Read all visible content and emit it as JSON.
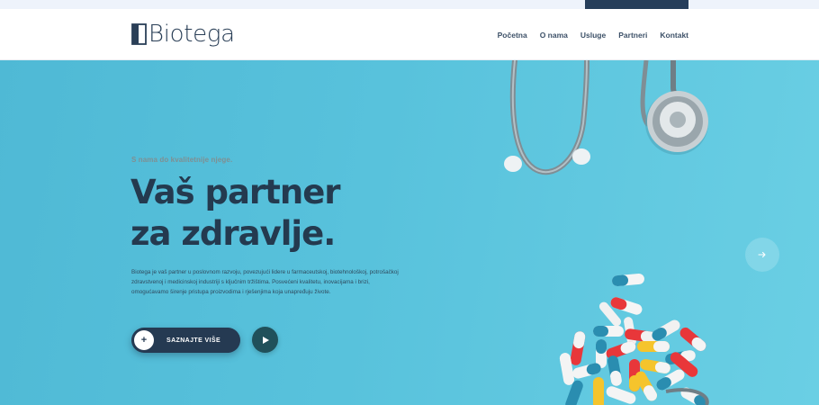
{
  "brand": {
    "name": "Biotega"
  },
  "nav": {
    "items": [
      "Početna",
      "O nama",
      "Usluge",
      "Partneri",
      "Kontakt"
    ]
  },
  "hero": {
    "tagline": "S nama do kvalitetnije njege.",
    "headline_line1": "Vaš partner",
    "headline_line2": "za zdravlje.",
    "description": "Biotega je vaš partner u poslovnom razvoju, povezujući lidere u farmaceutskoj, biotehnološkoj, potrošačkoj zdravstvenoj i medicinskoj industriji s ključnim tržištima. Posvećeni kvalitetu, inovacijama i brizi, omogućavamo širenje pristupa proizvodima i rješenjima koja unapređuju živote.",
    "cta_label": "SAZNAJTE VIŠE"
  },
  "icons": {
    "cta": "plus-icon",
    "play": "play-icon",
    "next": "arrow-right-icon"
  },
  "colors": {
    "brand_dark": "#253a52",
    "hero_bg": "#58c2dc",
    "play_bg": "#20505a",
    "topbar_accent": "#263e5a"
  }
}
